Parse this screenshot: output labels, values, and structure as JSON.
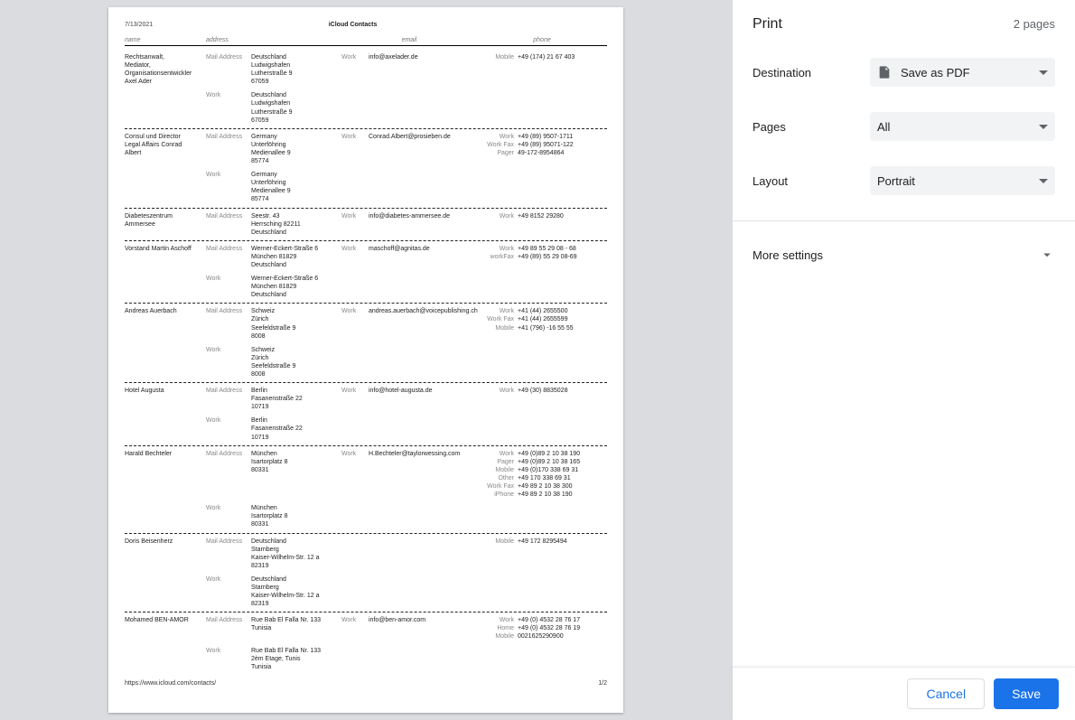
{
  "preview": {
    "date": "7/13/2021",
    "title": "iCloud Contacts",
    "footer_url": "https://www.icloud.com/contacts/",
    "footer_page": "1/2",
    "headers": {
      "name": "name",
      "address": "address",
      "email": "email",
      "phone": "phone"
    },
    "contacts": [
      {
        "name": "Rechtsanwalt,\nMediator,\nOrganisationsentwickler\nAxel Ader",
        "addresses": [
          {
            "label": "Mail Address",
            "text": "Deutschland\nLudwigshafen\nLutherstraße 9\n67059"
          },
          {
            "label": "Work",
            "text": "Deutschland\nLudwigshafen\nLutherstraße 9\n67059"
          }
        ],
        "emails": [
          {
            "label": "Work",
            "text": "info@axelader.de"
          }
        ],
        "phones": [
          {
            "label": "Mobile",
            "text": "+49 (174) 21 67 403"
          }
        ]
      },
      {
        "name": "Consul und Director\nLegal Affairs Conrad\nAlbert",
        "addresses": [
          {
            "label": "Mail Address",
            "text": "Germany\nUnterföhring\nMedienallee 9\n85774"
          },
          {
            "label": "Work",
            "text": "Germany\nUnterföhring\nMedienallee 9\n85774"
          }
        ],
        "emails": [
          {
            "label": "Work",
            "text": "Conrad.Albert@prosieben.de"
          }
        ],
        "phones": [
          {
            "label": "Work",
            "text": "+49 (89) 9507-1711"
          },
          {
            "label": "Work Fax",
            "text": "+49 (89) 95071-122"
          },
          {
            "label": "Pager",
            "text": "49-172-8954864"
          }
        ]
      },
      {
        "name": "Diabeteszentrum\nAmmersee",
        "addresses": [
          {
            "label": "Mail Address",
            "text": "Seestr. 43\nHerrsching 82211\nDeutschland"
          }
        ],
        "emails": [
          {
            "label": "Work",
            "text": "info@diabetes-ammersee.de"
          }
        ],
        "phones": [
          {
            "label": "Work",
            "text": "+49 8152 29280"
          }
        ]
      },
      {
        "name": "Vorstand Martin Aschoff",
        "addresses": [
          {
            "label": "Mail Address",
            "text": "Werner-Eckert-Straße 6\nMünchen 81829\nDeutschland"
          },
          {
            "label": "Work",
            "text": "Werner-Eckert-Straße 6\nMünchen 81829\nDeutschland"
          }
        ],
        "emails": [
          {
            "label": "Work",
            "text": "maschoff@agnitas.de"
          }
        ],
        "phones": [
          {
            "label": "Work",
            "text": "+49 89 55 29 08 - 68"
          },
          {
            "label": "workFax",
            "text": "+49 (89) 55 29 08-69"
          }
        ]
      },
      {
        "name": "Andreas Auerbach",
        "addresses": [
          {
            "label": "Mail Address",
            "text": "Schweiz\nZürich\nSeefeldstraße 9\n8008"
          },
          {
            "label": "Work",
            "text": "Schweiz\nZürich\nSeefeldstraße 9\n8008"
          }
        ],
        "emails": [
          {
            "label": "Work",
            "text": "andreas.auerbach@voicepublishing.ch"
          }
        ],
        "phones": [
          {
            "label": "Work",
            "text": "+41 (44) 2655500"
          },
          {
            "label": "Work Fax",
            "text": "+41 (44) 2655599"
          },
          {
            "label": "Mobile",
            "text": "+41 (796) -16 55 55"
          }
        ]
      },
      {
        "name": "Hotel Augusta",
        "addresses": [
          {
            "label": "Mail Address",
            "text": "Berlin\nFasanenstraße 22\n10719"
          },
          {
            "label": "Work",
            "text": "Berlin\nFasanenstraße 22\n10719"
          }
        ],
        "emails": [
          {
            "label": "Work",
            "text": "info@hotel-augusta.de"
          }
        ],
        "phones": [
          {
            "label": "Work",
            "text": "+49 (30) 8835028"
          }
        ]
      },
      {
        "name": "Harald Bechteler",
        "addresses": [
          {
            "label": "Mail Address",
            "text": "München\nIsartorplatz 8\n80331"
          },
          {
            "label": "Work",
            "text": "München\nIsartorplatz 8\n80331"
          }
        ],
        "emails": [
          {
            "label": "Work",
            "text": "H.Bechteler@taylorwessing.com"
          }
        ],
        "phones": [
          {
            "label": "Work",
            "text": "+49 (0)89 2 10 38 190"
          },
          {
            "label": "Pager",
            "text": "+49 (0)89 2 10 38 165"
          },
          {
            "label": "Mobile",
            "text": "+49 (0)170 338 69 31"
          },
          {
            "label": "Other",
            "text": "+49 170 338 69 31"
          },
          {
            "label": "Work Fax",
            "text": "+49 89 2 10 38 300"
          },
          {
            "label": "iPhone",
            "text": "+49 89 2 10 38 190"
          }
        ]
      },
      {
        "name": "Doris Beisenherz",
        "addresses": [
          {
            "label": "Mail Address",
            "text": "Deutschland\nStarnberg\nKaiser-Wilhelm-Str. 12 a\n82319"
          },
          {
            "label": "Work",
            "text": "Deutschland\nStarnberg\nKaiser-Wilhelm-Str. 12 a\n82319"
          }
        ],
        "emails": [],
        "phones": [
          {
            "label": "Mobile",
            "text": "+49 172 8295494"
          }
        ]
      },
      {
        "name": "Mohamed BEN-AMOR",
        "addresses": [
          {
            "label": "Mail Address",
            "text": "Rue Bab El Falla Nr. 133\nTunisia"
          },
          {
            "label": "Work",
            "text": "Rue Bab El Falla Nr. 133\n2èm Etage, Tunis\nTunisia"
          }
        ],
        "emails": [
          {
            "label": "Work",
            "text": "info@ben-amor.com"
          }
        ],
        "phones": [
          {
            "label": "Work",
            "text": "+49 (0) 4532 28 76 17"
          },
          {
            "label": "Home",
            "text": "+49 (0) 4532 28 76 19"
          },
          {
            "label": "Mobile",
            "text": "0021625290900"
          }
        ]
      }
    ]
  },
  "panel": {
    "title": "Print",
    "page_count": "2 pages",
    "options": {
      "destination": {
        "label": "Destination",
        "value": "Save as PDF"
      },
      "pages": {
        "label": "Pages",
        "value": "All"
      },
      "layout": {
        "label": "Layout",
        "value": "Portrait"
      }
    },
    "more_settings": "More settings",
    "buttons": {
      "cancel": "Cancel",
      "save": "Save"
    }
  }
}
